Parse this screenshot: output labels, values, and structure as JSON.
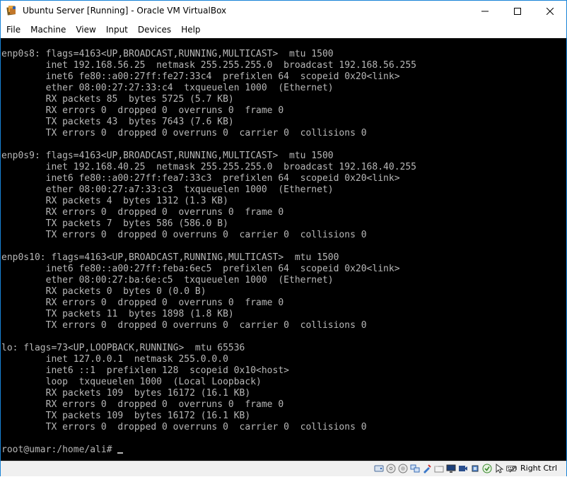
{
  "window": {
    "title": "Ubuntu Server [Running] - Oracle VM VirtualBox",
    "app_icon": "virtualbox-icon"
  },
  "menubar": {
    "items": [
      "File",
      "Machine",
      "View",
      "Input",
      "Devices",
      "Help"
    ]
  },
  "console": {
    "lines": [
      "enp0s8: flags=4163<UP,BROADCAST,RUNNING,MULTICAST>  mtu 1500",
      "        inet 192.168.56.25  netmask 255.255.255.0  broadcast 192.168.56.255",
      "        inet6 fe80::a00:27ff:fe27:33c4  prefixlen 64  scopeid 0x20<link>",
      "        ether 08:00:27:27:33:c4  txqueuelen 1000  (Ethernet)",
      "        RX packets 85  bytes 5725 (5.7 KB)",
      "        RX errors 0  dropped 0  overruns 0  frame 0",
      "        TX packets 43  bytes 7643 (7.6 KB)",
      "        TX errors 0  dropped 0 overruns 0  carrier 0  collisions 0",
      "",
      "enp0s9: flags=4163<UP,BROADCAST,RUNNING,MULTICAST>  mtu 1500",
      "        inet 192.168.40.25  netmask 255.255.255.0  broadcast 192.168.40.255",
      "        inet6 fe80::a00:27ff:fea7:33c3  prefixlen 64  scopeid 0x20<link>",
      "        ether 08:00:27:a7:33:c3  txqueuelen 1000  (Ethernet)",
      "        RX packets 4  bytes 1312 (1.3 KB)",
      "        RX errors 0  dropped 0  overruns 0  frame 0",
      "        TX packets 7  bytes 586 (586.0 B)",
      "        TX errors 0  dropped 0 overruns 0  carrier 0  collisions 0",
      "",
      "enp0s10: flags=4163<UP,BROADCAST,RUNNING,MULTICAST>  mtu 1500",
      "        inet6 fe80::a00:27ff:feba:6ec5  prefixlen 64  scopeid 0x20<link>",
      "        ether 08:00:27:ba:6e:c5  txqueuelen 1000  (Ethernet)",
      "        RX packets 0  bytes 0 (0.0 B)",
      "        RX errors 0  dropped 0  overruns 0  frame 0",
      "        TX packets 11  bytes 1898 (1.8 KB)",
      "        TX errors 0  dropped 0 overruns 0  carrier 0  collisions 0",
      "",
      "lo: flags=73<UP,LOOPBACK,RUNNING>  mtu 65536",
      "        inet 127.0.0.1  netmask 255.0.0.0",
      "        inet6 ::1  prefixlen 128  scopeid 0x10<host>",
      "        loop  txqueuelen 1000  (Local Loopback)",
      "        RX packets 109  bytes 16172 (16.1 KB)",
      "        RX errors 0  dropped 0  overruns 0  frame 0",
      "        TX packets 109  bytes 16172 (16.1 KB)",
      "        TX errors 0  dropped 0 overruns 0  carrier 0  collisions 0",
      ""
    ],
    "prompt": "root@umar:/home/ali# "
  },
  "statusbar": {
    "icons": [
      "hard-disk-icon",
      "optical-drive-icon",
      "audio-icon",
      "network-icon",
      "usb-icon",
      "shared-folders-icon",
      "display-icon",
      "video-capture-icon",
      "processor-icon",
      "virtualization-icon",
      "mouse-integration-icon",
      "keyboard-icon"
    ],
    "host_key": "Right Ctrl"
  },
  "colors": {
    "console_bg": "#000000",
    "console_fg": "#b7b7b7",
    "window_border": "#1883d7",
    "statusbar_bg": "#f0f0f0"
  }
}
